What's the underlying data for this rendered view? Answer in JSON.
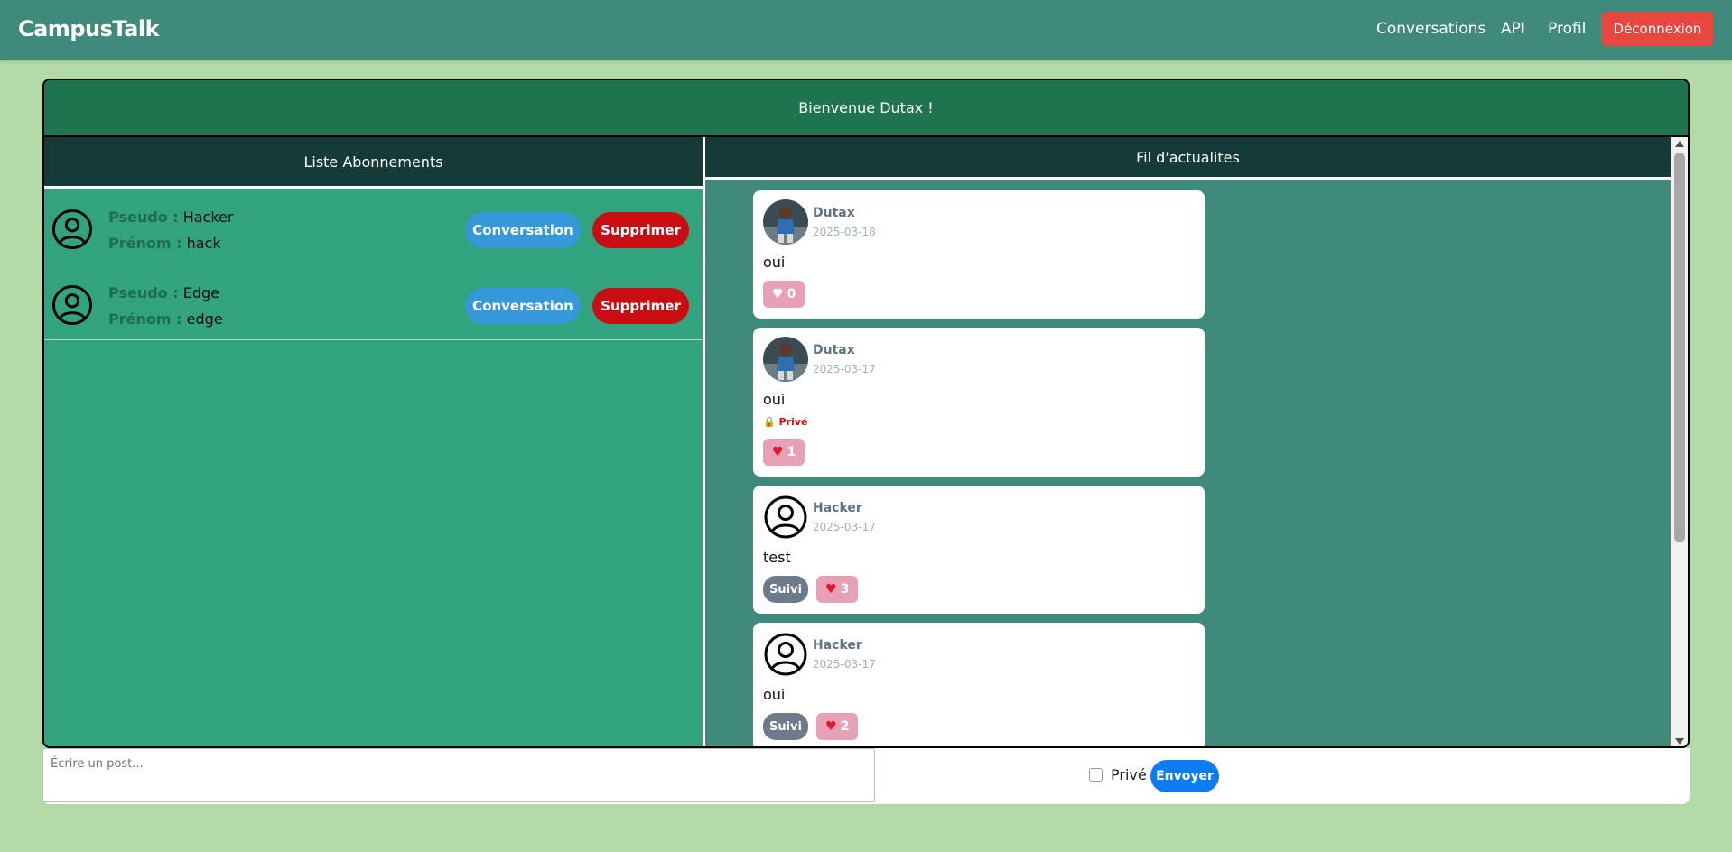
{
  "navbar": {
    "brand": "CampusTalk",
    "links": [
      {
        "label": "Conversations"
      },
      {
        "label": "API"
      },
      {
        "label": "Profil"
      }
    ],
    "logout_label": "Déconnexion"
  },
  "welcome": "Bienvenue Dutax !",
  "subscriptions": {
    "header": "Liste Abonnements",
    "pseudo_label": "Pseudo :",
    "prenom_label": "Prénom :",
    "conversation_label": "Conversation",
    "delete_label": "Supprimer",
    "items": [
      {
        "pseudo": "Hacker",
        "prenom": "hack"
      },
      {
        "pseudo": "Edge",
        "prenom": "edge"
      }
    ]
  },
  "feed": {
    "header": "Fil d'actualites",
    "posts": [
      {
        "author": "Dutax",
        "date": "2025-03-18",
        "text": "oui",
        "likes": "0",
        "avatar": "photo",
        "private": null,
        "follow": null,
        "liked": false
      },
      {
        "author": "Dutax",
        "date": "2025-03-17",
        "text": "oui",
        "likes": "1",
        "avatar": "photo",
        "private": "Privé",
        "follow": null,
        "liked": true
      },
      {
        "author": "Hacker",
        "date": "2025-03-17",
        "text": "test",
        "likes": "3",
        "avatar": "user-icon",
        "private": null,
        "follow": "Suivi",
        "liked": true
      },
      {
        "author": "Hacker",
        "date": "2025-03-17",
        "text": "oui",
        "likes": "2",
        "avatar": "user-icon",
        "private": null,
        "follow": "Suivi",
        "liked": true
      }
    ]
  },
  "composer": {
    "placeholder": "Écrire un post...",
    "private_label": "Privé",
    "send_label": "Envoyer"
  },
  "colors": {
    "navbar": "#408a7c",
    "page_bg": "#b2d9a6",
    "logout": "#e8473f",
    "conversation_btn": "#3498db",
    "delete_btn": "#c80e12",
    "send_btn": "#0d7cf2"
  }
}
